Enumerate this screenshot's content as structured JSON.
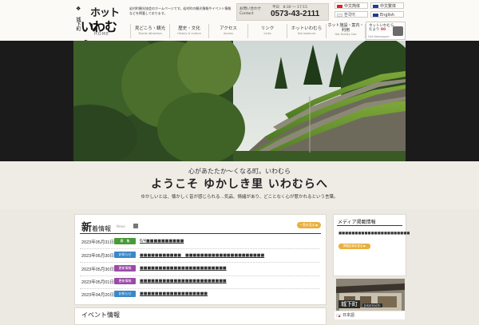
{
  "header": {
    "logo": {
      "kamon": "❖",
      "small": "城下町",
      "line1": "ホットい",
      "line2": "いわむら",
      "home": "HOME"
    },
    "tagline": "岩村町観光協会のホームページです。岩村町の観光情報やイベント情報などを掲載しております。",
    "contact": {
      "label": "お問い合わせ Contact",
      "hours": "平日　8:30 〜 17:15",
      "phone": "0573-43-2111"
    },
    "languages": [
      {
        "label": "中文简体",
        "flag_color": "#d22"
      },
      {
        "label": "中文繁体",
        "flag_color": "#1a3fa0"
      },
      {
        "label": "한국어",
        "flag_color": "#eee"
      },
      {
        "label": "English",
        "flag_color": "#233b88"
      }
    ],
    "nav": [
      {
        "jp": "見どころ・観光",
        "en": "Tourist attraction"
      },
      {
        "jp": "歴史・文化",
        "en": "History & culture"
      },
      {
        "jp": "アクセス",
        "en": "Access"
      },
      {
        "jp": "リンク",
        "en": "Links"
      },
      {
        "jp": "ホットいわむら",
        "en": "Hot iwamura"
      },
      {
        "jp": "ホット施設・案内・利用",
        "en": "Hot Facility Use"
      }
    ],
    "newsletter": {
      "line1": "ホットいわむら",
      "line2": "だより",
      "badge": "80",
      "en": "Hot Newspaper"
    }
  },
  "welcome": {
    "subtitle": "心があたたか〜くなる町。いわむら",
    "title": "ようこそ ゆかしき里 いわむらへ",
    "description": "ゆかしいとは、懐かしく昔が感じられる…気品、情緒があり、どことなく心が惹かれるという言葉。"
  },
  "news": {
    "title_big": "新",
    "title_rest": "着情報",
    "title_en": "News",
    "more_label": "一覧を見る ▶",
    "items": [
      {
        "date": "2023年05月31日",
        "badge": "募　集",
        "badge_color": "#4a9a3a",
        "text": "6/4■■■■■■■■■■"
      },
      {
        "date": "2023年05月30日",
        "badge": "お知らせ",
        "badge_color": "#3a88c8",
        "text": "■■■■■■■■■■■　■■■■■■■■■■■■■■■■■■■■■"
      },
      {
        "date": "2023年05月30日",
        "badge": "更新情報",
        "badge_color": "#9c4aa8",
        "text": "■■■■■■■■■■■■■■■■■■■■■■■"
      },
      {
        "date": "2023年05月01日",
        "badge": "更新情報",
        "badge_color": "#9c4aa8",
        "text": "■■■■■■■■■■■■■■■■■■■■■■■"
      },
      {
        "date": "2023年04月20日",
        "badge": "お知らせ",
        "badge_color": "#3a88c8",
        "text": "■■■■■■■■■■■■■■■■■■"
      }
    ]
  },
  "media": {
    "title": "メディア掲載情報",
    "text": "■■■■■■■■■■■■■■■■■■■■■■",
    "button": "掲載記事を見る ▶"
  },
  "joka": {
    "label": "城下町",
    "en": "Jokamachi"
  },
  "event": {
    "title": "イベント情報"
  },
  "footer_lang": {
    "label": "日本語"
  }
}
